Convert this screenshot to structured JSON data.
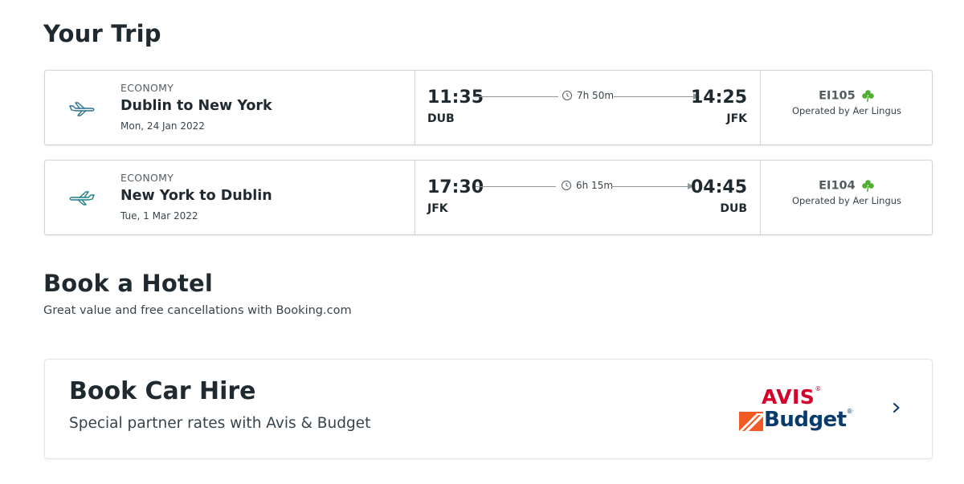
{
  "trip": {
    "title": "Your Trip",
    "flights": [
      {
        "cabin": "ECONOMY",
        "route": "Dublin to New York",
        "date": "Mon, 24 Jan 2022",
        "departure_time": "11:35",
        "departure_code": "DUB",
        "duration": "7h 50m",
        "arrival_time": "14:25",
        "arrival_code": "JFK",
        "flight_number": "EI105",
        "operator": "Operated by Aer Lingus",
        "icon": "plane-takeoff-icon"
      },
      {
        "cabin": "ECONOMY",
        "route": "New York to Dublin",
        "date": "Tue, 1 Mar 2022",
        "departure_time": "17:30",
        "departure_code": "JFK",
        "duration": "6h 15m",
        "arrival_time": "04:45",
        "arrival_code": "DUB",
        "flight_number": "EI104",
        "operator": "Operated by Aer Lingus",
        "icon": "plane-return-icon"
      }
    ]
  },
  "hotel": {
    "title": "Book a Hotel",
    "subtitle": "Great value and free cancellations with Booking.com"
  },
  "car_hire": {
    "title": "Book Car Hire",
    "subtitle": "Special partner rates with Avis & Budget",
    "logo_avis": "AVIS",
    "logo_budget": "Budget",
    "chevron_icon": "chevron-right-icon"
  },
  "colors": {
    "text": "#1f2a30",
    "muted": "#535c61",
    "plane_blue": "#2d6f91",
    "plane_teal": "#1d7f83",
    "shamrock": "#4fae2f",
    "avis_red": "#d4002a",
    "budget_orange": "#f15a22",
    "budget_navy": "#0b3b6b",
    "chevron": "#0b3b6b"
  }
}
